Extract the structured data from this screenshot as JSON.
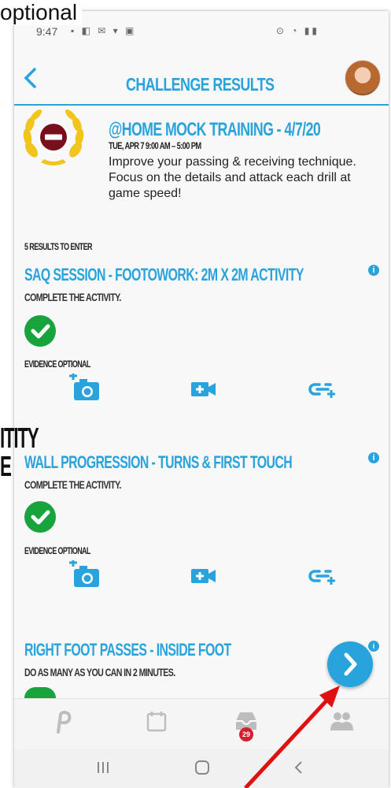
{
  "annotations": {
    "top_text": "optional",
    "left_text_lines": [
      "ITITY",
      "E"
    ]
  },
  "status_bar": {
    "time": "9:47",
    "left_icons": "▪ ◧ ✉ ▾ ▣",
    "right_icons": "⊙ ◔ ▮▮"
  },
  "header": {
    "back_icon": "chevron-left",
    "title": "CHALLENGE RESULTS"
  },
  "challenge": {
    "title": "@HOME MOCK TRAINING - 4/7/20",
    "datetime": "TUE, APR 7 9:00 AM – 5:00 PM",
    "description": "Improve your passing & receiving technique. Focus on the details and attack each drill at game speed!"
  },
  "results_count": "5 RESULTS TO ENTER",
  "activities": [
    {
      "title": "SAQ SESSION - FOOTOWORK: 2M X 2M ACTIVITY",
      "subtitle": "COMPLETE THE ACTIVITY.",
      "evidence_label": "EVIDENCE OPTIONAL"
    },
    {
      "title": "WALL PROGRESSION - TURNS & FIRST TOUCH",
      "subtitle": "COMPLETE THE ACTIVITY.",
      "evidence_label": "EVIDENCE OPTIONAL"
    },
    {
      "title": "RIGHT FOOT PASSES - INSIDE FOOT",
      "subtitle": "DO AS MANY AS YOU CAN IN 2 MINUTES."
    }
  ],
  "nav": {
    "inbox_badge": "29"
  },
  "colors": {
    "accent": "#29a3dc",
    "success": "#18a33c",
    "badge_red": "#d51f2e",
    "arrow_red": "#e01010"
  }
}
